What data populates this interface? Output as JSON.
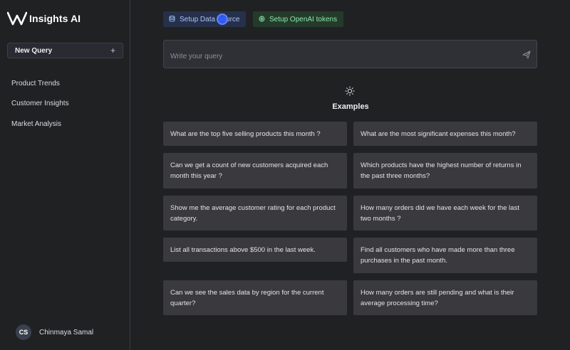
{
  "app": {
    "name": "Insights AI"
  },
  "sidebar": {
    "new_query_label": "New Query",
    "new_query_icon": "+",
    "items": [
      {
        "label": "Product Trends"
      },
      {
        "label": "Customer Insights"
      },
      {
        "label": "Market Analysis"
      }
    ],
    "user": {
      "initials": "CS",
      "name": "Chinmaya Samal"
    }
  },
  "toolbar": {
    "setup_data_source": "Setup Data Source",
    "setup_openai": "Setup OpenAI tokens"
  },
  "query": {
    "placeholder": "Write your query"
  },
  "examples": {
    "title": "Examples",
    "items": [
      "What are the top five selling products this month ?",
      "What are the most significant expenses this month?",
      "Can we get a count of new customers acquired each month this year ?",
      "Which products have the highest number of returns in the past three months?",
      "Show me the average customer rating for each product category.",
      "How many orders did we have each week for the last two months ?",
      "List all transactions above $500 in the last week.",
      "Find all customers who have made more than three purchases in the past month.",
      "Can we see the sales data by region for the current quarter?",
      "How many orders are still pending and what is their average processing time?"
    ]
  },
  "colors": {
    "background": "#202123",
    "card": "#3a3a3e",
    "data_source_accent": "#a9c4ff",
    "openai_accent": "#8ee6a5"
  }
}
